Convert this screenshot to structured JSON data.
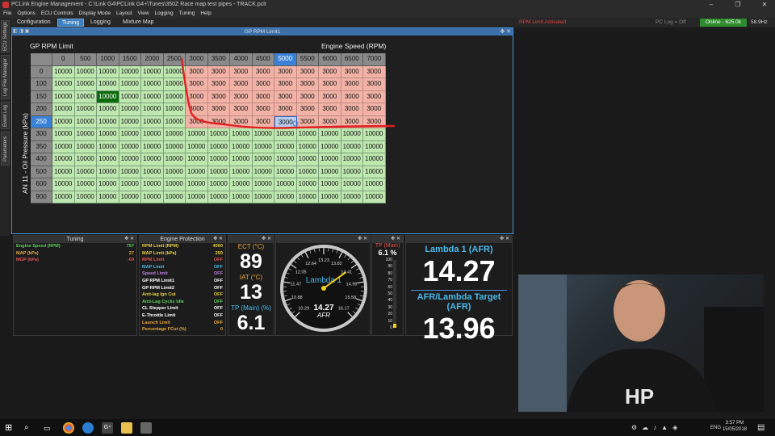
{
  "window": {
    "title": "PCLink Engine Management - C:\\Link G4\\PCLink G4+\\Tunes\\350Z Race map test pipes - TRACK.pclr",
    "controls": [
      "–",
      "❐",
      "✕"
    ]
  },
  "menu": [
    "File",
    "Options",
    "ECU Controls",
    "Display Mode",
    "Layout",
    "View",
    "Logging",
    "Tuning",
    "Help"
  ],
  "tabs": [
    "Configuration",
    "Tuning",
    "Logging",
    "Mixture Map"
  ],
  "active_tab": "Tuning",
  "status": {
    "rpm_limit": "RPM Limit Activated",
    "pc_log": "PC Log = Off",
    "online": "Online - 625.0k",
    "fps": "58.9Hz"
  },
  "side_tabs": [
    "ECU Settings",
    "Log File Manager",
    "Event Log",
    "Parameters"
  ],
  "table_panel": {
    "header": "GP RPM Limit1",
    "title": "GP RPM Limit",
    "x_label": "Engine Speed (RPM)",
    "y_label": "AN 11 - Oil Pressure (kPa)",
    "x_axis": [
      "0",
      "500",
      "1000",
      "1500",
      "2000",
      "2500",
      "3000",
      "3500",
      "4000",
      "4500",
      "5000",
      "5500",
      "6000",
      "6500",
      "7000"
    ],
    "y_axis": [
      "0",
      "100",
      "150",
      "200",
      "250",
      "300",
      "350",
      "400",
      "500",
      "600",
      "900"
    ],
    "rows": [
      [
        "10000",
        "10000",
        "10000",
        "10000",
        "10000",
        "10000",
        "3000",
        "3000",
        "3000",
        "3000",
        "3000",
        "3000",
        "3000",
        "3000",
        "3000"
      ],
      [
        "10000",
        "10000",
        "10000",
        "10000",
        "10000",
        "10000",
        "3000",
        "3000",
        "3000",
        "3000",
        "3000",
        "3000",
        "3000",
        "3000",
        "3000"
      ],
      [
        "10000",
        "10000",
        "10000",
        "10000",
        "10000",
        "10000",
        "3000",
        "3000",
        "3000",
        "3000",
        "3000",
        "3000",
        "3000",
        "3000",
        "3000"
      ],
      [
        "10000",
        "10000",
        "10000",
        "10000",
        "10000",
        "10000",
        "3000",
        "3000",
        "3000",
        "3000",
        "3000",
        "3000",
        "3000",
        "3000",
        "3000"
      ],
      [
        "10000",
        "10000",
        "10000",
        "10000",
        "10000",
        "10000",
        "3000",
        "3000",
        "3000",
        "3000",
        "3000",
        "3000",
        "3000",
        "3000",
        "3000"
      ],
      [
        "10000",
        "10000",
        "10000",
        "10000",
        "10000",
        "10000",
        "10000",
        "10000",
        "10000",
        "10000",
        "10000",
        "10000",
        "10000",
        "10000",
        "10000"
      ],
      [
        "10000",
        "10000",
        "10000",
        "10000",
        "10000",
        "10000",
        "10000",
        "10000",
        "10000",
        "10000",
        "10000",
        "10000",
        "10000",
        "10000",
        "10000"
      ],
      [
        "10000",
        "10000",
        "10000",
        "10000",
        "10000",
        "10000",
        "10000",
        "10000",
        "10000",
        "10000",
        "10000",
        "10000",
        "10000",
        "10000",
        "10000"
      ],
      [
        "10000",
        "10000",
        "10000",
        "10000",
        "10000",
        "10000",
        "10000",
        "10000",
        "10000",
        "10000",
        "10000",
        "10000",
        "10000",
        "10000",
        "10000"
      ],
      [
        "10000",
        "10000",
        "10000",
        "10000",
        "10000",
        "10000",
        "10000",
        "10000",
        "10000",
        "10000",
        "10000",
        "10000",
        "10000",
        "10000",
        "10000"
      ],
      [
        "10000",
        "10000",
        "10000",
        "10000",
        "10000",
        "10000",
        "10000",
        "10000",
        "10000",
        "10000",
        "10000",
        "10000",
        "10000",
        "10000",
        "10000"
      ]
    ],
    "selected_row": "250",
    "selected_col": "5000"
  },
  "tuning_panel": {
    "title": "Tuning",
    "items": [
      {
        "label": "Engine Speed (RPM)",
        "value": "797",
        "color": "#5ad05a"
      },
      {
        "label": "MAP (kPa)",
        "value": "27",
        "color": "#e8a640"
      },
      {
        "label": "MGP (kPa)",
        "value": "-69",
        "color": "#e05050"
      }
    ]
  },
  "protection_panel": {
    "title": "Engine Protection",
    "items": [
      {
        "label": "RPM Limit (RPM)",
        "value": "4000",
        "color": "#e8d040"
      },
      {
        "label": "MAP Limit (kPa)",
        "value": "250",
        "color": "#e8d040"
      },
      {
        "label": "RPM Limit",
        "value": "OFF",
        "color": "#e05050"
      },
      {
        "label": "MAP Limit",
        "value": "OFF",
        "color": "#4ab8e8"
      },
      {
        "label": "Speed Limit",
        "value": "OFF",
        "color": "#c080e0"
      },
      {
        "label": "GP RPM Limit1",
        "value": "OFF",
        "color": "#ffffff"
      },
      {
        "label": "GP RPM Limit2",
        "value": "OFF",
        "color": "#ffffff"
      },
      {
        "label": "Anti-lag Ign Cut",
        "value": "OFF",
        "color": "#e8d040"
      },
      {
        "label": "Anti-Lag Cyclic Idle",
        "value": "OFF",
        "color": "#5ad05a"
      },
      {
        "label": "CL Stepper Limit",
        "value": "OFF",
        "color": "#ffffff"
      },
      {
        "label": "E-Throttle Limit",
        "value": "OFF",
        "color": "#ffffff"
      },
      {
        "label": "Launch Limit",
        "value": "OFF",
        "color": "#e8a640"
      },
      {
        "label": "Percentage FCut (%)",
        "value": "0",
        "color": "#e8a640"
      }
    ]
  },
  "gauges": {
    "ect_label": "ECT (°C)",
    "ect_value": "89",
    "iat_label": "IAT (°C)",
    "iat_value": "13",
    "tp_label": "TP (Main) (%)",
    "tp_value": "6.1"
  },
  "dial": {
    "title": "Lambda 1",
    "value": "14.27",
    "unit": "AFR",
    "ticks": [
      "10.29",
      "10.88",
      "11.47",
      "12.05",
      "12.64",
      "13.23",
      "13.82",
      "14.41",
      "14.99",
      "15.58",
      "16.17"
    ],
    "needle_fraction": 0.7
  },
  "tp_bar": {
    "title": "TP (Main)",
    "value": "6.1 %",
    "ticks": [
      "100",
      "90",
      "80",
      "70",
      "60",
      "50",
      "40",
      "30",
      "20",
      "10",
      "0"
    ],
    "fill_fraction": 0.061
  },
  "lambda": {
    "afr_label": "Lambda 1 (AFR)",
    "afr_value": "14.27",
    "target_label": "AFR/Lambda Target (AFR)",
    "target_value": "13.96"
  },
  "taskbar": {
    "time": "3:57 PM",
    "date": "15/05/2018",
    "lang": "ENG"
  },
  "colors": {
    "accent": "#3d7fbf",
    "online": "#2e8b2e",
    "warn": "#e04040"
  }
}
